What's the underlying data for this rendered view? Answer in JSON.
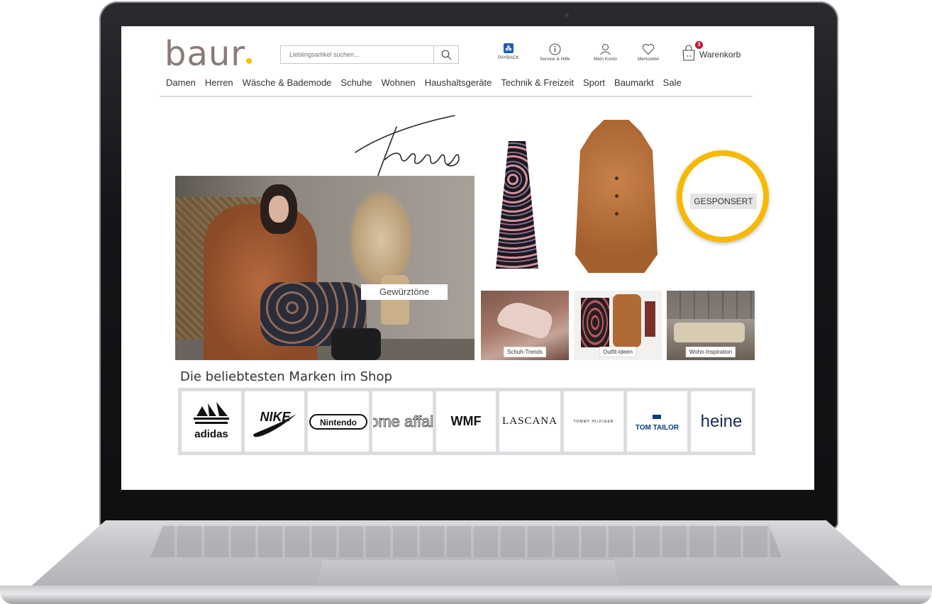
{
  "header": {
    "logo": "baur",
    "search_placeholder": "Lieblingsartikel suchen...",
    "icons": [
      {
        "label": "PAYBACK",
        "icon": "payback-icon"
      },
      {
        "label": "Service & Hilfe",
        "icon": "info-icon"
      },
      {
        "label": "Mein Konto",
        "icon": "user-icon"
      },
      {
        "label": "Merkzettel",
        "icon": "heart-icon"
      }
    ],
    "cart": {
      "label": "Warenkorb",
      "count": "3"
    }
  },
  "nav": [
    "Damen",
    "Herren",
    "Wäsche & Bademode",
    "Schuhe",
    "Wohnen",
    "Haushaltsgeräte",
    "Technik & Freizeit",
    "Sport",
    "Baumarkt",
    "Sale"
  ],
  "hero": {
    "script_title": "Trends",
    "main_label": "Gewürztöne",
    "sponsored": "GESPONSERT",
    "tiles": [
      {
        "label": "Schuh-Trends"
      },
      {
        "label": "Outfit-Ideen"
      },
      {
        "label": "Wohn-Inspiration"
      }
    ]
  },
  "brands": {
    "title": "Die beliebtesten Marken im Shop",
    "items": [
      "adidas",
      "NIKE",
      "Nintendo",
      "Home affaire",
      "WMF",
      "LASCANA",
      "TOMMY HILFIGER",
      "TOM TAILOR",
      "heine"
    ]
  },
  "colors": {
    "logo_dot": "#f5c200",
    "cart_badge": "#c81432",
    "highlight_ring": "#f7b900",
    "payback": "#1c5db5"
  }
}
